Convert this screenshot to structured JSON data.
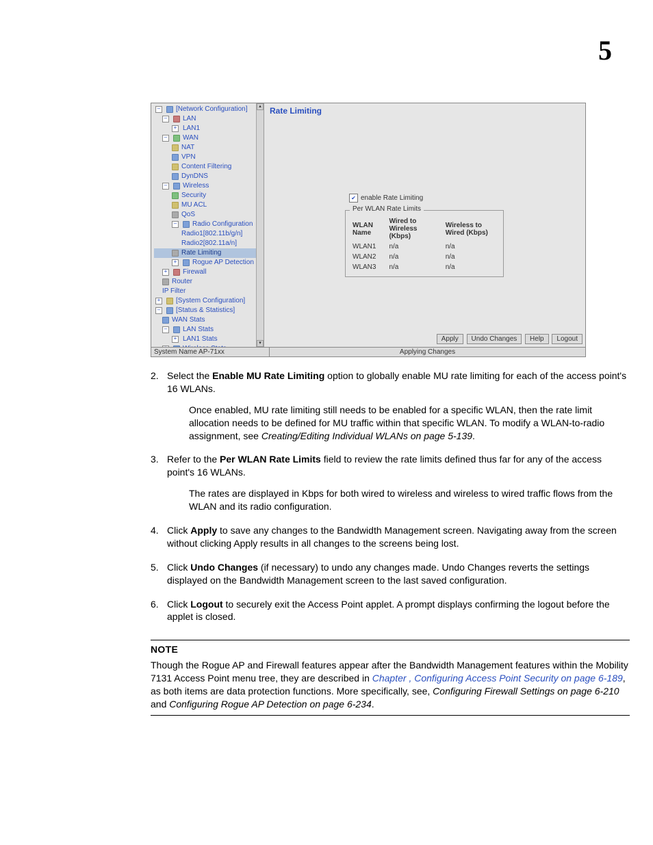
{
  "chapter_number": "5",
  "screenshot": {
    "title": "Rate Limiting",
    "tree": {
      "root": "[Network Configuration]",
      "lan": "LAN",
      "lan1": "LAN1",
      "wan": "WAN",
      "nat": "NAT",
      "vpn": "VPN",
      "content_filtering": "Content Filtering",
      "dyndns": "DynDNS",
      "wireless": "Wireless",
      "security": "Security",
      "mu_acl": "MU ACL",
      "qos": "QoS",
      "radio_config": "Radio Configuration",
      "radio1": "Radio1[802.11b/g/n]",
      "radio2": "Radio2[802.11a/n]",
      "rate_limiting": "Rate Limiting",
      "rogue_ap": "Rogue AP Detection",
      "firewall": "Firewall",
      "router": "Router",
      "ip_filter": "IP Filter",
      "sys_config": "[System Configuration]",
      "status_stats": "[Status & Statistics]",
      "wan_stats": "WAN Stats",
      "lan_stats": "LAN Stats",
      "lan1_stats": "LAN1 Stats",
      "wireless_stats": "Wireless Stats"
    },
    "checkbox_label": "enable Rate Limiting",
    "fieldset_legend": "Per WLAN Rate Limits",
    "table": {
      "headers": {
        "c1": "WLAN Name",
        "c2": "Wired to Wireless (Kbps)",
        "c3": "Wireless to Wired (Kbps)"
      },
      "rows": [
        {
          "c1": "WLAN1",
          "c2": "n/a",
          "c3": "n/a"
        },
        {
          "c1": "WLAN2",
          "c2": "n/a",
          "c3": "n/a"
        },
        {
          "c1": "WLAN3",
          "c2": "n/a",
          "c3": "n/a"
        }
      ]
    },
    "buttons": {
      "apply": "Apply",
      "undo": "Undo Changes",
      "help": "Help",
      "logout": "Logout"
    },
    "status_left": "System Name AP-71xx",
    "status_right": "Applying Changes"
  },
  "steps": {
    "s2": {
      "num": "2.",
      "pre": "Select the ",
      "bold": "Enable MU Rate Limiting",
      "post": " option to globally enable MU rate limiting for each of the access point's 16 WLANs.",
      "para2_pre": "Once enabled, MU rate limiting still needs to be enabled for a specific WLAN, then the rate limit allocation needs to be defined for MU traffic within that specific WLAN. To modify a WLAN-to-radio assignment, see ",
      "para2_ital": "Creating/Editing Individual WLANs on page 5-139",
      "para2_post": "."
    },
    "s3": {
      "num": "3.",
      "pre": "Refer to the ",
      "bold": "Per WLAN Rate Limits",
      "post": " field to review the rate limits defined thus far for any of the access point's 16 WLANs.",
      "para2": "The rates are displayed in Kbps for both wired to wireless and wireless to wired traffic flows from the WLAN and its radio configuration."
    },
    "s4": {
      "num": "4.",
      "pre": "Click ",
      "bold": "Apply",
      "post": " to save any changes to the Bandwidth Management screen. Navigating away from the screen without clicking Apply results in all changes to the screens being lost."
    },
    "s5": {
      "num": "5.",
      "pre": "Click ",
      "bold": "Undo Changes",
      "post": " (if necessary) to undo any changes made. Undo Changes reverts the settings displayed on the Bandwidth Management screen to the last saved configuration."
    },
    "s6": {
      "num": "6.",
      "pre": "Click ",
      "bold": "Logout",
      "post": " to securely exit the Access Point applet. A prompt displays confirming the logout before the applet is closed."
    }
  },
  "note": {
    "heading": "NOTE",
    "pre": "Though the Rogue AP and Firewall features appear after the Bandwidth Management features within the Mobility 7131 Access Point menu tree, they are described in ",
    "link": "Chapter , Configuring Access Point Security on page 6-189",
    "mid": ", as both items are data protection functions. More specifically, see, ",
    "ital1": "Configuring Firewall Settings on page 6-210",
    "and": " and ",
    "ital2": "Configuring Rogue AP Detection on page 6-234",
    "post": "."
  }
}
